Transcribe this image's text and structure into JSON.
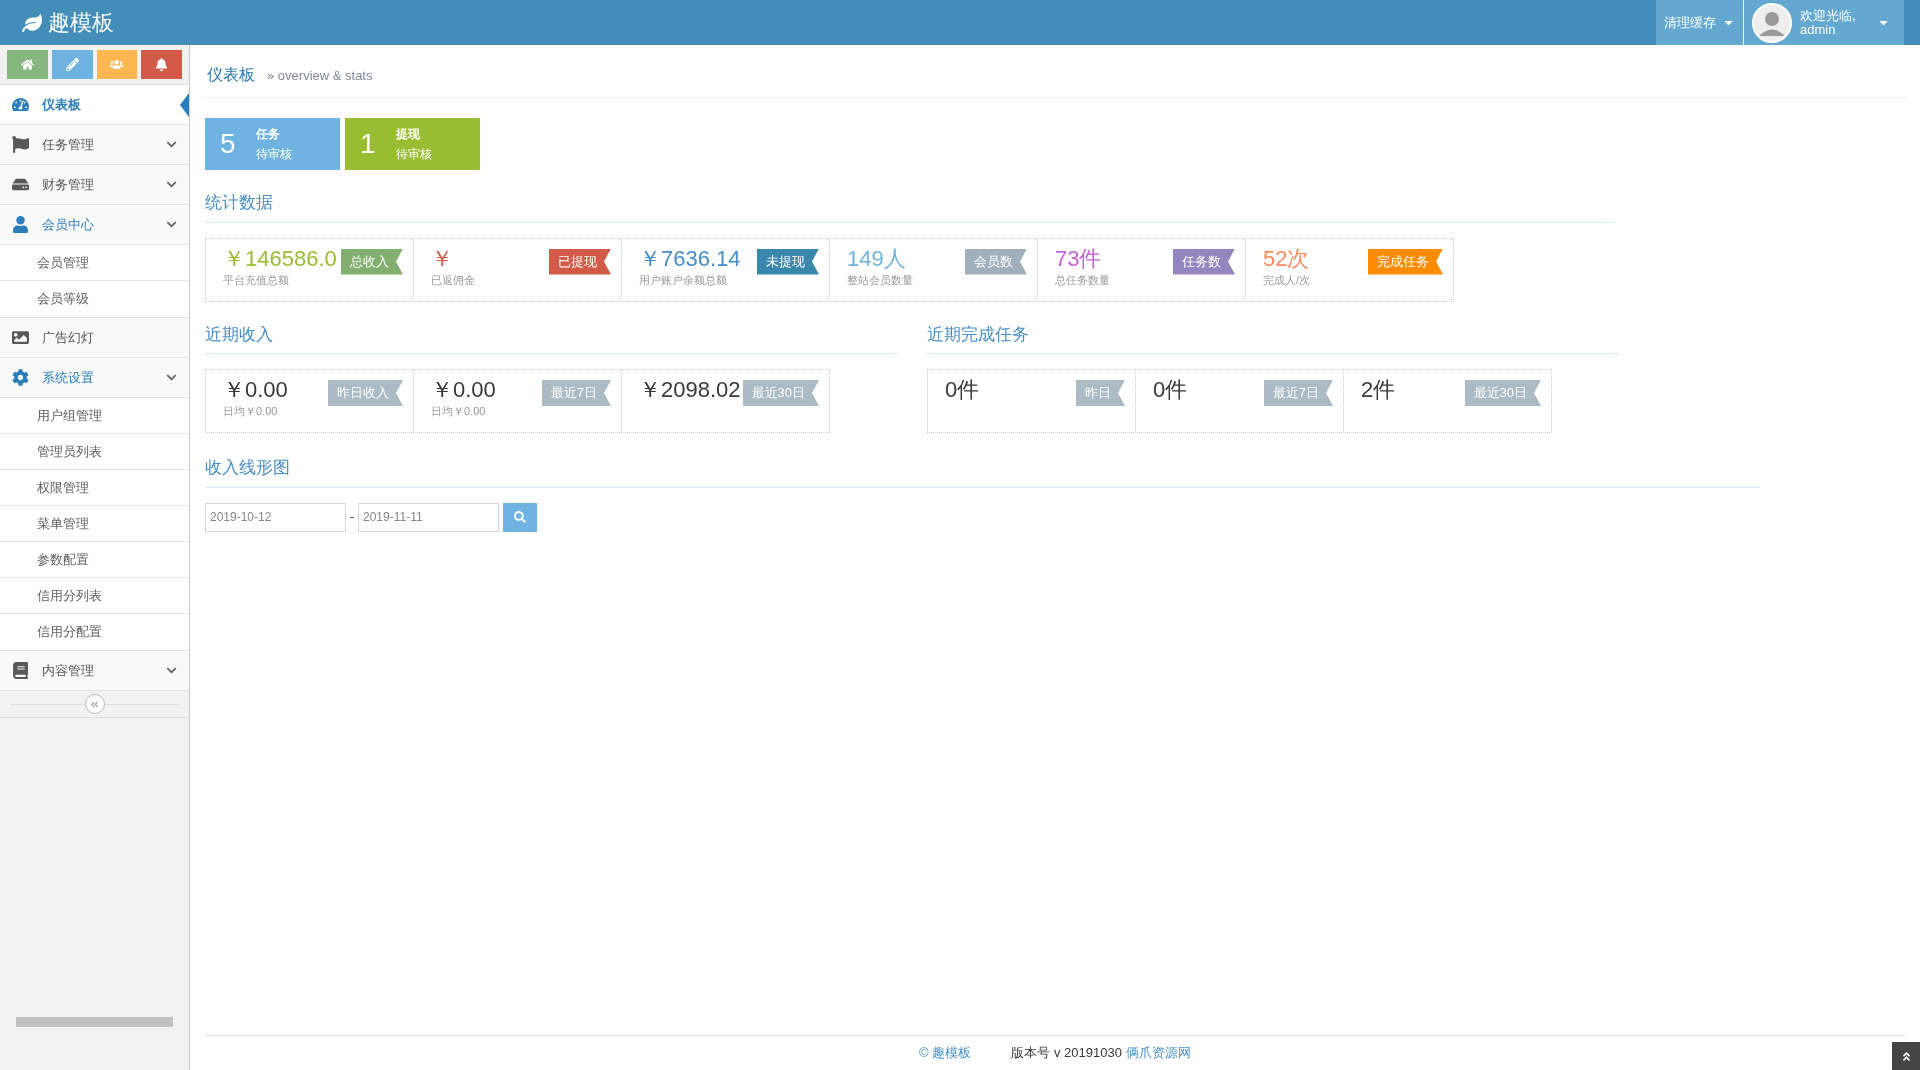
{
  "header": {
    "brand": "趣模板",
    "clear_cache": "清理缓存",
    "welcome": "欢迎光临,",
    "user": "admin"
  },
  "shortcuts": [
    {
      "kind": "home",
      "color": "#87b87f"
    },
    {
      "kind": "pencil",
      "color": "#6fb3e0"
    },
    {
      "kind": "users",
      "color": "#ffb752"
    },
    {
      "kind": "bell",
      "color": "#d15b47"
    }
  ],
  "sidebar": {
    "items": [
      {
        "label": "仪表板",
        "selected": true,
        "expanded": false,
        "has_children": false
      },
      {
        "label": "任务管理",
        "selected": false,
        "expanded": false,
        "has_children": true
      },
      {
        "label": "财务管理",
        "selected": false,
        "expanded": false,
        "has_children": true
      },
      {
        "label": "会员中心",
        "selected": false,
        "expanded": true,
        "has_children": true,
        "children": [
          {
            "label": "会员管理"
          },
          {
            "label": "会员等级"
          }
        ]
      },
      {
        "label": "广告幻灯",
        "selected": false,
        "expanded": false,
        "has_children": false
      },
      {
        "label": "系统设置",
        "selected": false,
        "expanded": true,
        "has_children": true,
        "children": [
          {
            "label": "用户组管理"
          },
          {
            "label": "管理员列表"
          },
          {
            "label": "权限管理"
          },
          {
            "label": "菜单管理"
          },
          {
            "label": "参数配置"
          },
          {
            "label": "信用分列表"
          },
          {
            "label": "信用分配置"
          }
        ]
      },
      {
        "label": "内容管理",
        "selected": false,
        "expanded": false,
        "has_children": true
      }
    ]
  },
  "breadcrumb": {
    "title": "仪表板",
    "subtitle": "» overview & stats"
  },
  "pending": [
    {
      "count": "5",
      "line1": "任务",
      "line2": "待审核",
      "color": "#6fb3e0"
    },
    {
      "count": "1",
      "line1": "提现",
      "line2": "待审核",
      "color": "#9abc32"
    }
  ],
  "stats": {
    "title": "统计数据",
    "cards": [
      {
        "value": {
          "text": "￥146586.0",
          "color": "#9abc32"
        },
        "label": "平台充值总额",
        "badge": {
          "text": "总收入",
          "color": "#82af6f"
        }
      },
      {
        "value": {
          "text": "￥",
          "color": "#d15b47"
        },
        "label": "已返佣金",
        "badge": {
          "text": "已提现",
          "color": "#d15b47"
        }
      },
      {
        "value": {
          "text": "￥7636.14",
          "color": "#478fca"
        },
        "label": "用户账户余额总额",
        "badge": {
          "text": "未提现",
          "color": "#3a87ad"
        }
      },
      {
        "value": {
          "text": "149人",
          "color": "#6fb3e0"
        },
        "label": "整站会员数量",
        "badge": {
          "text": "会员数",
          "color": "#a0afbc"
        }
      },
      {
        "value": {
          "text": "73件",
          "color": "#c85fd4"
        },
        "label": "总任务数量",
        "badge": {
          "text": "任务数",
          "color": "#9585bf"
        }
      },
      {
        "value": {
          "text": "52次",
          "color": "#ff8a5c"
        },
        "label": "完成人/次",
        "badge": {
          "text": "完成任务",
          "color": "#ff8c00"
        }
      }
    ]
  },
  "recent_income": {
    "title": "近期收入",
    "cards": [
      {
        "value": "￥0.00",
        "label": "日均￥0.00",
        "badge": "昨日收入"
      },
      {
        "value": "￥0.00",
        "label": "日均￥0.00",
        "badge": "最近7日"
      },
      {
        "value": "￥2098.02",
        "badge": "最近30日"
      }
    ]
  },
  "recent_tasks": {
    "title": "近期完成任务",
    "cards": [
      {
        "value": "0件",
        "badge": "昨日"
      },
      {
        "value": "0件",
        "badge": "最近7日"
      },
      {
        "value": "2件",
        "badge": "最近30日"
      }
    ]
  },
  "chart_section": {
    "title": "收入线形图",
    "date_from": "2019-10-12",
    "separator": "-",
    "date_to": "2019-11-11"
  },
  "footer": {
    "brand": "© 趣模板",
    "version": "版本号 v 20191030",
    "source": "俩爪资源网"
  }
}
